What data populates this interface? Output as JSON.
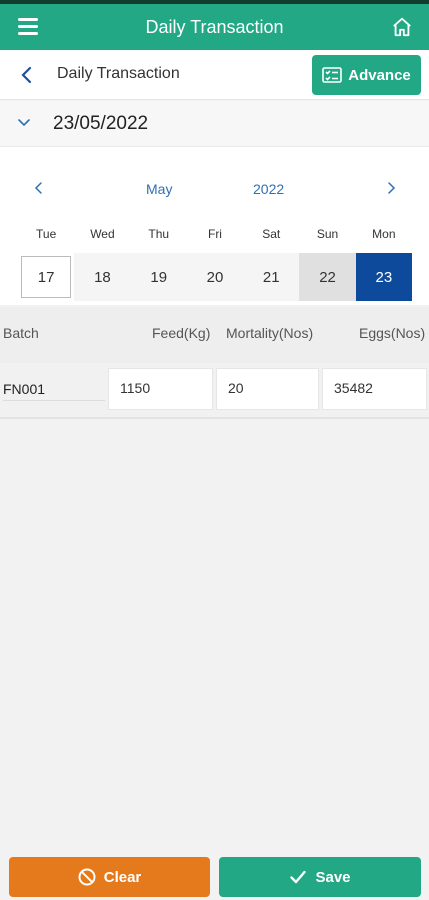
{
  "appbar": {
    "title": "Daily Transaction"
  },
  "subbar": {
    "title": "Daily Transaction",
    "advance_label": "Advance"
  },
  "date_selector": {
    "value": "23/05/2022"
  },
  "calendar": {
    "month": "May",
    "year": "2022",
    "weekdays": [
      "Tue",
      "Wed",
      "Thu",
      "Fri",
      "Sat",
      "Sun",
      "Mon"
    ],
    "days": [
      "17",
      "18",
      "19",
      "20",
      "21",
      "22",
      "23"
    ],
    "selected_day": "23",
    "selected_color": "#0d4a9c"
  },
  "table": {
    "headers": {
      "batch": "Batch",
      "feed": "Feed(Kg)",
      "mortality": "Mortality(Nos)",
      "eggs": "Eggs(Nos)"
    },
    "rows": [
      {
        "batch": "FN001",
        "feed": "1150",
        "mortality": "20",
        "eggs": "35482"
      }
    ]
  },
  "footer": {
    "clear_label": "Clear",
    "save_label": "Save"
  },
  "colors": {
    "primary": "#22a884",
    "clear": "#e57a1c"
  }
}
